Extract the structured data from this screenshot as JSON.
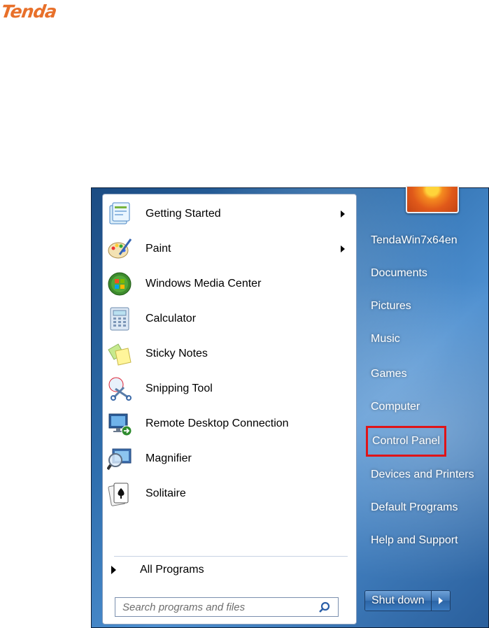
{
  "brand": {
    "logo_text": "Tenda",
    "logo_color": "#e8702a"
  },
  "start_menu": {
    "programs": [
      {
        "label": "Getting Started",
        "icon": "getting-started-icon",
        "has_submenu": true
      },
      {
        "label": "Paint",
        "icon": "paint-icon",
        "has_submenu": true
      },
      {
        "label": "Windows Media Center",
        "icon": "windows-media-center-icon",
        "has_submenu": false
      },
      {
        "label": "Calculator",
        "icon": "calculator-icon",
        "has_submenu": false
      },
      {
        "label": "Sticky Notes",
        "icon": "sticky-notes-icon",
        "has_submenu": false
      },
      {
        "label": "Snipping Tool",
        "icon": "snipping-tool-icon",
        "has_submenu": false
      },
      {
        "label": "Remote Desktop Connection",
        "icon": "remote-desktop-icon",
        "has_submenu": false
      },
      {
        "label": "Magnifier",
        "icon": "magnifier-icon",
        "has_submenu": false
      },
      {
        "label": "Solitaire",
        "icon": "solitaire-icon",
        "has_submenu": false
      }
    ],
    "all_programs_label": "All Programs",
    "search": {
      "placeholder": "Search programs and files",
      "value": ""
    },
    "right_items": [
      {
        "label": "TendaWin7x64en",
        "highlighted": false
      },
      {
        "label": "Documents",
        "highlighted": false
      },
      {
        "label": "Pictures",
        "highlighted": false
      },
      {
        "label": "Music",
        "highlighted": false
      },
      {
        "label": "Games",
        "highlighted": false
      },
      {
        "label": "Computer",
        "highlighted": false
      },
      {
        "label": "Control Panel",
        "highlighted": true
      },
      {
        "label": "Devices and Printers",
        "highlighted": false
      },
      {
        "label": "Default Programs",
        "highlighted": false
      },
      {
        "label": "Help and Support",
        "highlighted": false
      }
    ],
    "shutdown_label": "Shut down",
    "highlight_color": "#e01418"
  }
}
